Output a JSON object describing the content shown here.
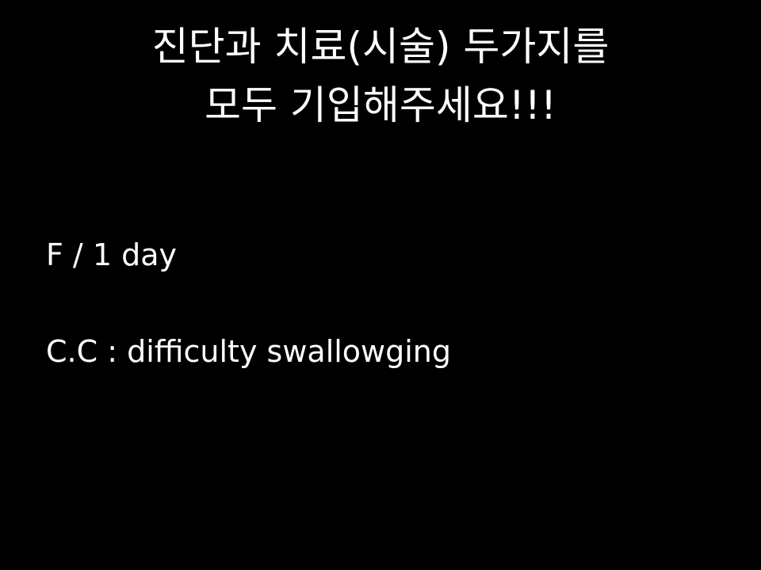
{
  "slide": {
    "title_lines": [
      "진단과 치료(시술) 두가지를",
      "모두 기입해주세요!!!"
    ],
    "body_lines": [
      "F / 1 day",
      "C.C : difficulty swallowging"
    ],
    "colors": {
      "background": "#000000",
      "text": "#ffffff"
    }
  }
}
